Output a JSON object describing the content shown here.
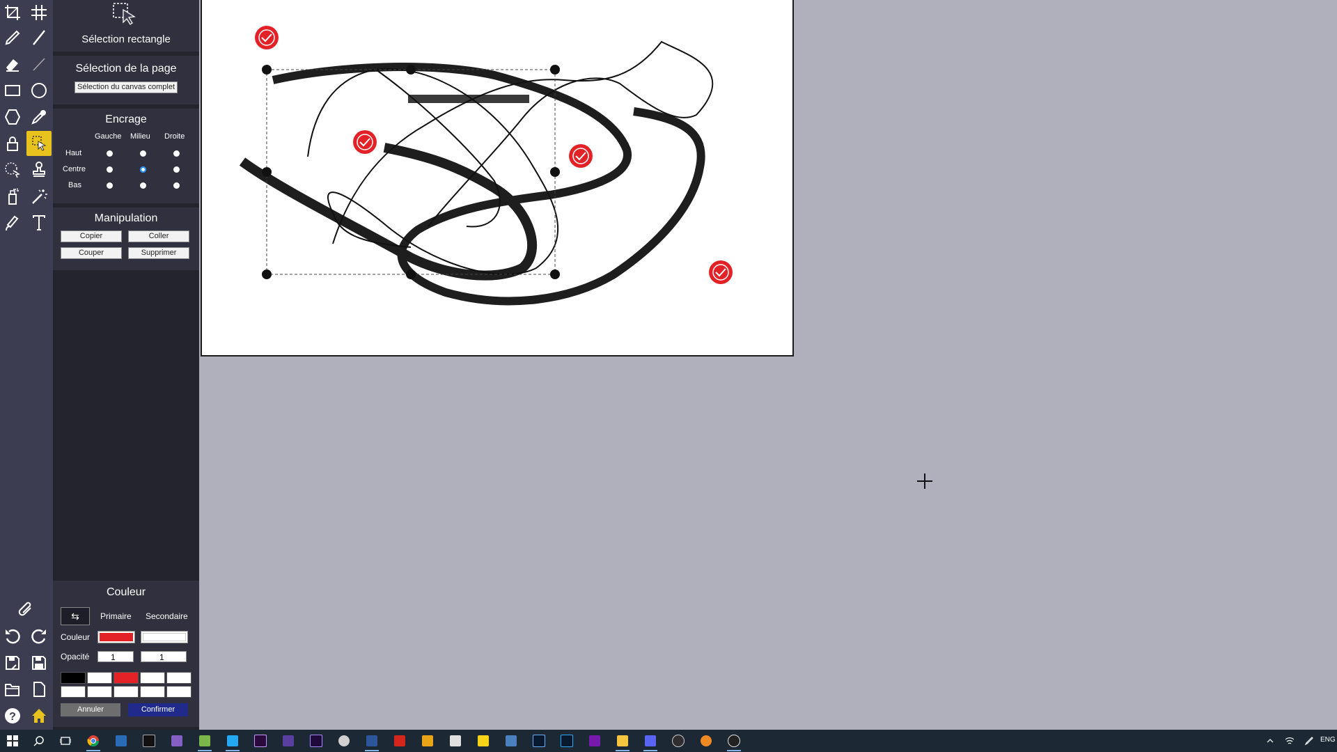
{
  "tool_panel": {
    "selection_title": "Sélection rectangle",
    "page_selection": {
      "title": "Sélection de la page",
      "button": "Sélection du canvas complet"
    },
    "inking": {
      "title": "Encrage",
      "columns": [
        "Gauche",
        "Milieu",
        "Droite"
      ],
      "rows": [
        "Haut",
        "Centre",
        "Bas"
      ],
      "selected": "Centre-Milieu"
    },
    "manipulation": {
      "title": "Manipulation",
      "copy": "Copier",
      "paste": "Coller",
      "cut": "Couper",
      "delete": "Supprimer"
    },
    "color": {
      "title": "Couleur",
      "swap": "⇆",
      "primary": "Primaire",
      "secondary": "Secondaire",
      "color_label": "Couleur",
      "opacity_label": "Opacité",
      "primary_color": "#e32227",
      "secondary_color": "#ffffff",
      "primary_opacity": "1",
      "secondary_opacity": "1",
      "palette_row1": [
        "#000000",
        "#ffffff",
        "#e32227",
        "#ffffff",
        "#ffffff"
      ],
      "palette_row2": [
        "#ffffff",
        "#ffffff",
        "#ffffff",
        "#ffffff",
        "#ffffff"
      ],
      "cancel": "Annuler",
      "confirm": "Confirmer"
    }
  },
  "colors": {
    "toolbar_bg": "#3d3d52",
    "panel_bg": "#24242f",
    "active_tool": "#e8c21d",
    "workspace": "#afb0bb",
    "confirm_btn": "#1f2a8a",
    "cancel_btn": "#6e6e6e",
    "stamp": "#e32227"
  },
  "taskbar": {
    "language": "ENG",
    "apps": [
      "start",
      "search",
      "task-view",
      "chrome",
      "powershell",
      "terminal",
      "visual-studio",
      "notepad-plus",
      "vscode",
      "premiere",
      "app-purple",
      "after-effects",
      "paint",
      "word",
      "acrobat",
      "transfer",
      "excel",
      "sticky-notes",
      "calculator",
      "lightroom",
      "photoshop",
      "onenote",
      "file-explorer",
      "discord",
      "obs",
      "media-player",
      "clock-app"
    ]
  }
}
